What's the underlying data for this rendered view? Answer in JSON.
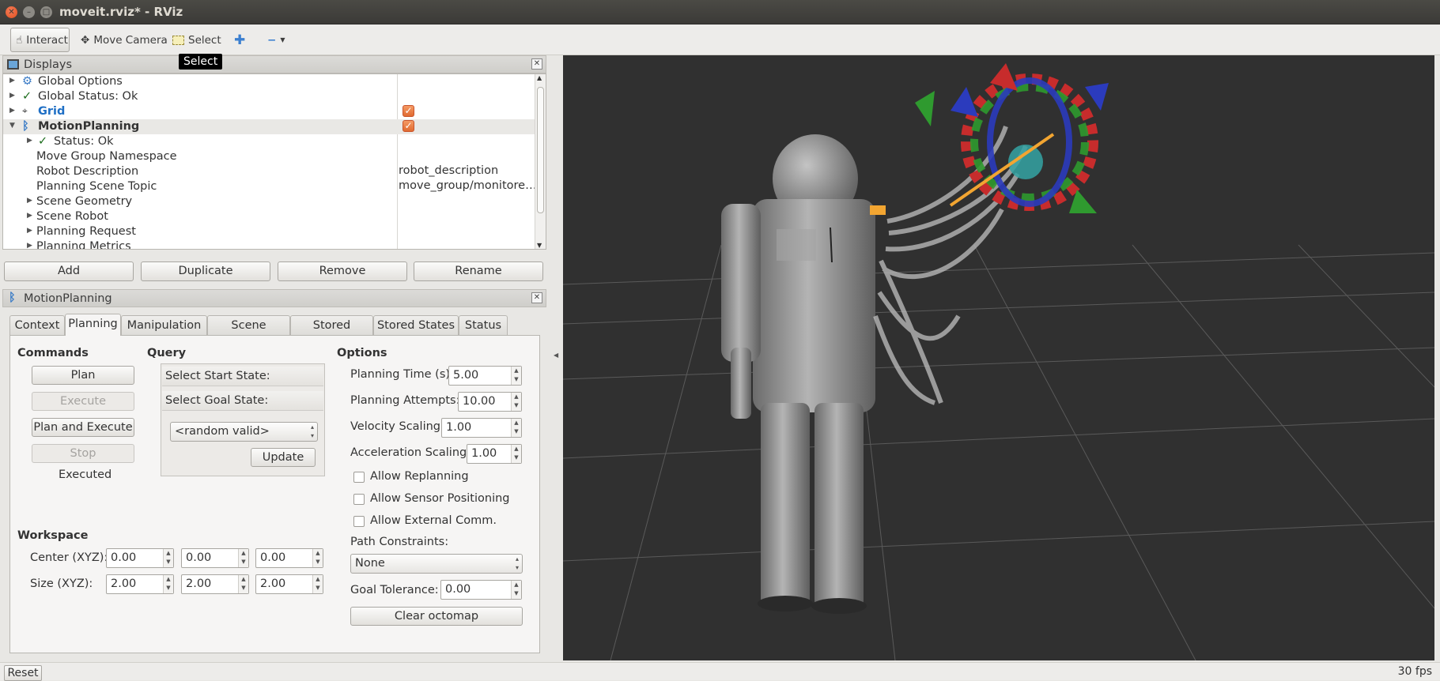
{
  "window": {
    "title": "moveit.rviz* - RViz"
  },
  "toolbar": {
    "interact": "Interact",
    "move_camera": "Move Camera",
    "select": "Select",
    "tooltip": "Select"
  },
  "displays": {
    "title": "Displays",
    "rows": [
      {
        "label": "Global Options",
        "value": ""
      },
      {
        "label": "Global Status: Ok",
        "value": ""
      },
      {
        "label": "Grid",
        "value": ""
      },
      {
        "label": "MotionPlanning",
        "value": ""
      },
      {
        "label": "Status: Ok",
        "value": ""
      },
      {
        "label": "Move Group Namespace",
        "value": ""
      },
      {
        "label": "Robot Description",
        "value": "robot_description"
      },
      {
        "label": "Planning Scene Topic",
        "value": "move_group/monitore…"
      },
      {
        "label": "Scene Geometry",
        "value": ""
      },
      {
        "label": "Scene Robot",
        "value": ""
      },
      {
        "label": "Planning Request",
        "value": ""
      },
      {
        "label": "Planning Metrics",
        "value": ""
      }
    ],
    "buttons": {
      "add": "Add",
      "duplicate": "Duplicate",
      "remove": "Remove",
      "rename": "Rename"
    }
  },
  "motion_planning": {
    "title": "MotionPlanning",
    "tabs": [
      "Context",
      "Planning",
      "Manipulation",
      "Scene Objects",
      "Stored Scenes",
      "Stored States",
      "Status"
    ],
    "active_tab": "Planning",
    "commands": {
      "heading": "Commands",
      "plan": "Plan",
      "execute": "Execute",
      "plan_and_execute": "Plan and Execute",
      "stop": "Stop",
      "status": "Executed"
    },
    "query": {
      "heading": "Query",
      "start_state": "Select Start State:",
      "goal_state": "Select Goal State:",
      "goal_value": "<random valid>",
      "update": "Update"
    },
    "options": {
      "heading": "Options",
      "planning_time_label": "Planning Time (s):",
      "planning_time": "5.00",
      "planning_attempts_label": "Planning Attempts:",
      "planning_attempts": "10.00",
      "velocity_scaling_label": "Velocity Scaling:",
      "velocity_scaling": "1.00",
      "acceleration_scaling_label": "Acceleration Scaling:",
      "acceleration_scaling": "1.00",
      "allow_replanning": "Allow Replanning",
      "allow_sensor_positioning": "Allow Sensor Positioning",
      "allow_external_comm": "Allow External Comm.",
      "path_constraints_label": "Path Constraints:",
      "path_constraints": "None",
      "goal_tolerance_label": "Goal Tolerance:",
      "goal_tolerance": "0.00",
      "clear_octomap": "Clear octomap"
    },
    "workspace": {
      "heading": "Workspace",
      "center_label": "Center (XYZ):",
      "center": [
        "0.00",
        "0.00",
        "0.00"
      ],
      "size_label": "Size (XYZ):",
      "size": [
        "2.00",
        "2.00",
        "2.00"
      ]
    }
  },
  "statusbar": {
    "reset": "Reset",
    "fps": "30 fps"
  },
  "colors": {
    "titlebar": "#3c3b37",
    "viewport_bg": "#303030",
    "checkbox_orange": "#e8703a",
    "grid_link": "#1f6fc5"
  }
}
